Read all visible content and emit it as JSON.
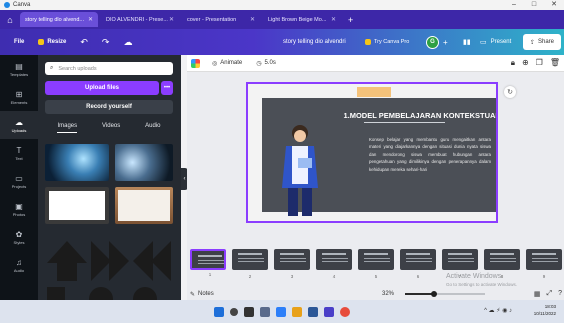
{
  "window": {
    "app_name": "Canva",
    "controls": [
      "–",
      "□",
      "✕"
    ]
  },
  "browser_tabs": [
    {
      "label": "story telling dlo alvend...",
      "active": true
    },
    {
      "label": "DIO ALVENDRI - Prese...",
      "active": false
    },
    {
      "label": "cover - Presentation",
      "active": false
    },
    {
      "label": "Light Brown Beige Mo...",
      "active": false
    }
  ],
  "toolbar": {
    "file_label": "File",
    "resize_label": "Resize",
    "doc_title": "story telling dio alvendri",
    "try_pro_label": "Try Canva Pro",
    "avatar_initial": "G",
    "present_label": "Present",
    "share_label": "Share"
  },
  "rail": [
    {
      "label": "Templates",
      "icon": "template-icon"
    },
    {
      "label": "Elements",
      "icon": "elements-icon"
    },
    {
      "label": "Uploads",
      "icon": "upload-icon",
      "active": true
    },
    {
      "label": "Text",
      "icon": "text-icon"
    },
    {
      "label": "Projects",
      "icon": "folder-icon"
    },
    {
      "label": "Photos",
      "icon": "photo-icon"
    },
    {
      "label": "Styles",
      "icon": "styles-icon"
    },
    {
      "label": "Audio",
      "icon": "audio-icon"
    }
  ],
  "panel": {
    "search_placeholder": "Search uploads",
    "upload_label": "Upload files",
    "more_label": "•••",
    "record_label": "Record yourself",
    "tabs": [
      "Images",
      "Videos",
      "Audio"
    ],
    "active_tab": "Images"
  },
  "editor": {
    "animate_label": "Animate",
    "duration_label": "5.0s"
  },
  "slide": {
    "heading": "1.MODEL PEMBELAJARAN KONTEKSTUAL",
    "body": "Konsep belajar yang membantu guru mengaitkan antara materi yang diajarkannya dengan situasi dunia nyata siswa dan mendorong siswa membuat hubungan antara pengetahuan yang dimilikinya dengan penerapannya dalam kehidupan mereka sehari-hari"
  },
  "pages": [
    {
      "num": "1",
      "selected": true
    },
    {
      "num": "2",
      "selected": false
    },
    {
      "num": "3",
      "selected": false
    },
    {
      "num": "4",
      "selected": false
    },
    {
      "num": "5",
      "selected": false
    },
    {
      "num": "6",
      "selected": false
    },
    {
      "num": "7",
      "selected": false
    },
    {
      "num": "8",
      "selected": false
    },
    {
      "num": "9",
      "selected": false
    }
  ],
  "watermark": {
    "title": "Activate Windows",
    "subtitle": "Go to Settings to activate Windows."
  },
  "footer": {
    "notes_label": "Notes",
    "zoom": "32%",
    "zoom_fraction": 0.32
  },
  "taskbar": {
    "time": "18:03",
    "date": "10/11/2022"
  },
  "colors": {
    "accent": "#8b3dff",
    "toolbar_start": "#3e2db0",
    "toolbar_end": "#2eb3c9",
    "panel_bg": "#252a31",
    "rail_bg": "#0e1318"
  }
}
